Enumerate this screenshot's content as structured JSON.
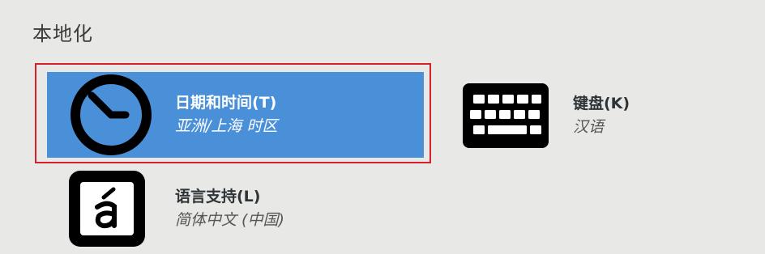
{
  "section": {
    "title": "本地化"
  },
  "spokes": {
    "datetime": {
      "name": "日期和时间(T)",
      "value": "亚洲/上海 时区",
      "icon": "clock-icon",
      "selected": true
    },
    "keyboard": {
      "name": "键盘(K)",
      "value": "汉语",
      "icon": "keyboard-icon"
    },
    "language": {
      "name": "语言支持(L)",
      "value": "简体中文 (中国)",
      "icon": "language-icon"
    }
  },
  "colors": {
    "background": "#e8e8e7",
    "selected": "#4a90d9",
    "focus_ring": "#d8202a",
    "icon": "#000000"
  }
}
